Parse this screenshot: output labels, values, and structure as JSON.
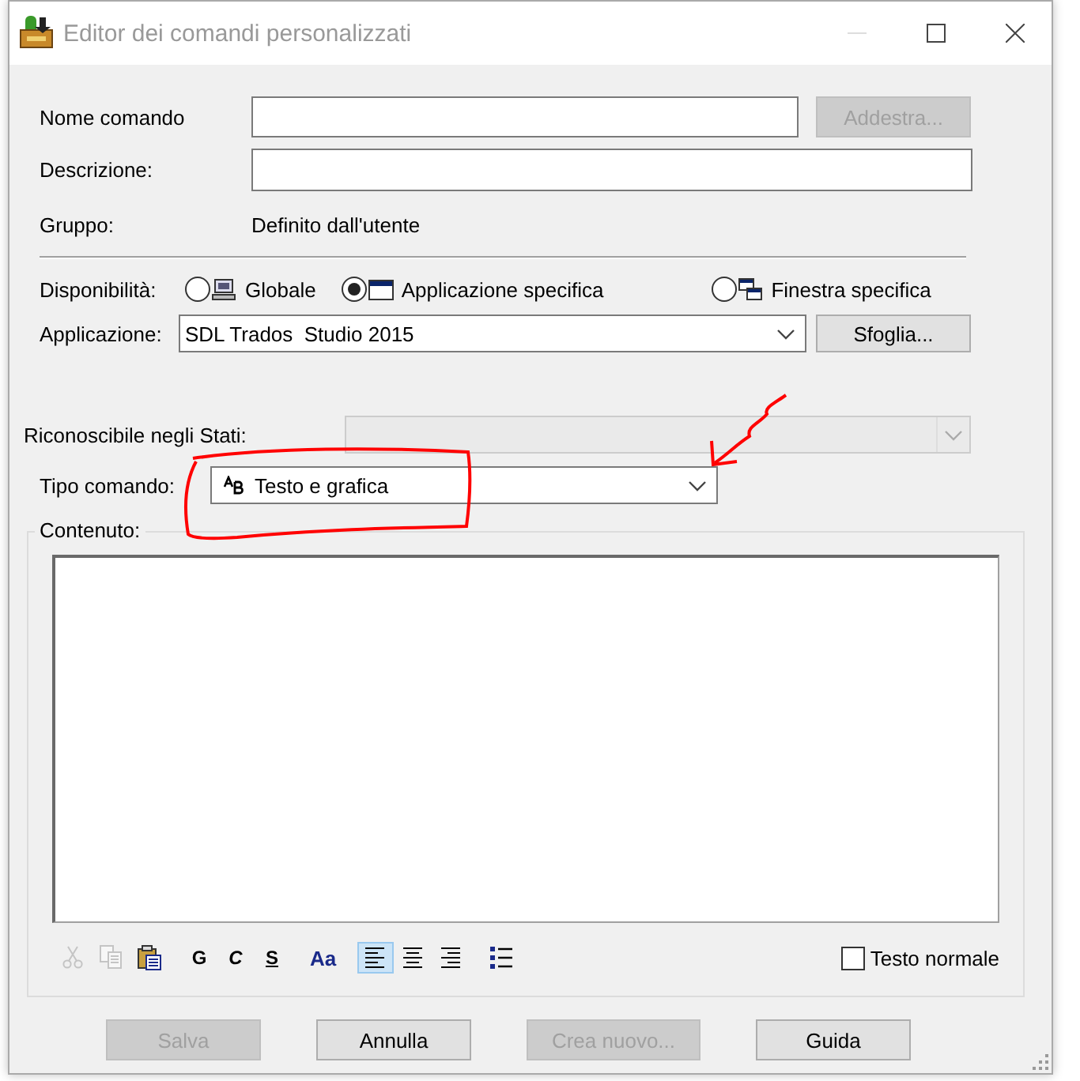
{
  "window": {
    "title": "Editor dei comandi personalizzati"
  },
  "command_name": {
    "label": "Nome comando",
    "train_button": {
      "label": "Addestra...",
      "disabled": true
    }
  },
  "description": {
    "label": "Descrizione:"
  },
  "group": {
    "label": "Gruppo:",
    "value": "Definito dall'utente"
  },
  "availability": {
    "label": "Disponibilità:",
    "options": [
      {
        "kind": "computer",
        "label": "Globale",
        "selected": false
      },
      {
        "kind": "app-window",
        "label": "Applicazione specifica",
        "selected": true
      },
      {
        "kind": "window-pair",
        "label": "Finestra specifica",
        "selected": false
      }
    ]
  },
  "application": {
    "label": "Applicazione:",
    "value": "SDL Trados  Studio 2015",
    "browse_button": {
      "label": "Sfoglia...",
      "disabled": false
    }
  },
  "states": {
    "label": "Riconoscibile negli Stati:",
    "disabled": true
  },
  "command_type": {
    "label": "Tipo comando:",
    "value": "Testo e grafica"
  },
  "content": {
    "label": "Contenuto:",
    "toolbar": [
      {
        "kind": "cut",
        "disabled": true,
        "selected": false
      },
      {
        "kind": "copy",
        "disabled": true,
        "selected": false
      },
      {
        "kind": "paste",
        "disabled": false,
        "selected": false
      },
      {
        "kind": "letter",
        "label": "G",
        "disabled": false,
        "selected": false
      },
      {
        "kind": "letter",
        "label": "C",
        "disabled": false,
        "selected": false
      },
      {
        "kind": "letter",
        "label": "S",
        "disabled": false,
        "selected": false
      },
      {
        "kind": "letter",
        "label": "Aa",
        "disabled": false,
        "selected": false
      },
      {
        "kind": "align-left",
        "disabled": false,
        "selected": true
      },
      {
        "kind": "align-center",
        "disabled": false,
        "selected": false
      },
      {
        "kind": "align-right",
        "disabled": false,
        "selected": false
      },
      {
        "kind": "bullets",
        "disabled": false,
        "selected": false
      }
    ],
    "plain_text": {
      "label": "Testo normale",
      "checked": false
    }
  },
  "buttons": [
    {
      "label": "Salva",
      "disabled": true
    },
    {
      "label": "Annulla",
      "disabled": false
    },
    {
      "label": "Crea nuovo...",
      "disabled": true
    },
    {
      "label": "Guida",
      "disabled": false
    }
  ]
}
